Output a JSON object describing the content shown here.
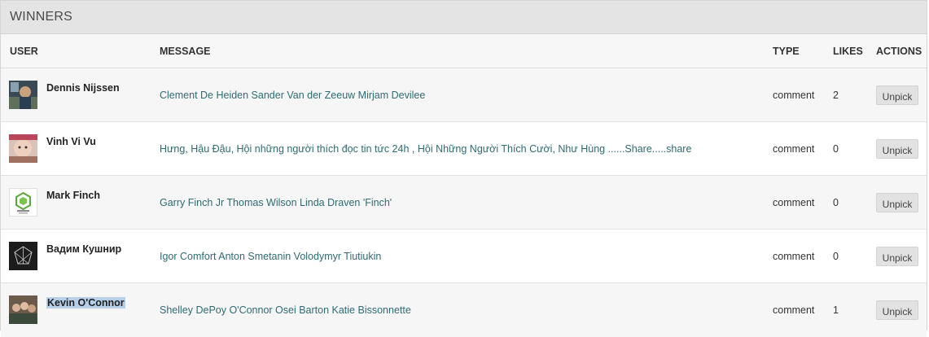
{
  "panel": {
    "title": "WINNERS"
  },
  "columns": {
    "user": "USER",
    "message": "MESSAGE",
    "type": "TYPE",
    "likes": "LIKES",
    "actions": "ACTIONS"
  },
  "rows": [
    {
      "user": "Dennis Nijssen",
      "message": "Clement De Heiden Sander Van der Zeeuw Mirjam Devilee",
      "type": "comment",
      "likes": "2",
      "action": "Unpick"
    },
    {
      "user": "Vinh Vi Vu",
      "message": "Hưng, Hậu Đậu, Hội những người thích đọc tin tức 24h , Hội Những Người Thích Cười, Như Hùng ......Share.....share",
      "type": "comment",
      "likes": "0",
      "action": "Unpick"
    },
    {
      "user": "Mark Finch",
      "message": "Garry Finch Jr Thomas Wilson Linda Draven 'Finch'",
      "type": "comment",
      "likes": "0",
      "action": "Unpick"
    },
    {
      "user": "Вадим Кушнир",
      "message": "Igor Comfort Anton Smetanin Volodymyr Tiutiukin",
      "type": "comment",
      "likes": "0",
      "action": "Unpick"
    },
    {
      "user": "Kevin O'Connor",
      "message": "Shelley DePoy O'Connor Osei Barton Katie Bissonnette",
      "type": "comment",
      "likes": "1",
      "action": "Unpick"
    }
  ],
  "colors": {
    "link": "#2f6b73",
    "header_bg": "#e4e4e4",
    "selection": "#b7d0ea"
  }
}
